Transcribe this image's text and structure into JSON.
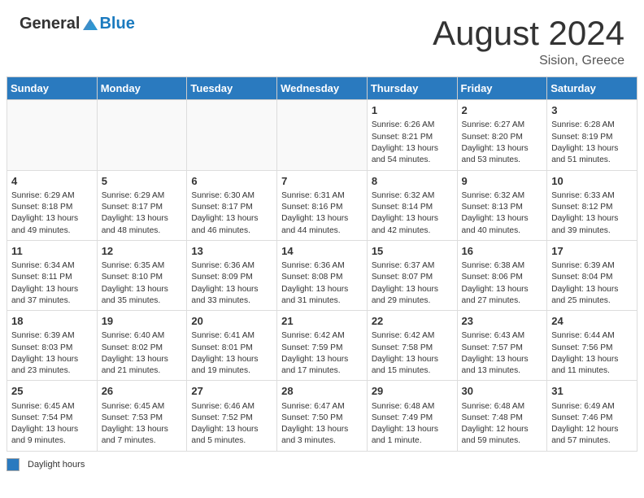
{
  "header": {
    "logo_general": "General",
    "logo_blue": "Blue",
    "month_title": "August 2024",
    "subtitle": "Sision, Greece"
  },
  "days_of_week": [
    "Sunday",
    "Monday",
    "Tuesday",
    "Wednesday",
    "Thursday",
    "Friday",
    "Saturday"
  ],
  "legend_label": "Daylight hours",
  "weeks": [
    [
      {
        "day": "",
        "info": ""
      },
      {
        "day": "",
        "info": ""
      },
      {
        "day": "",
        "info": ""
      },
      {
        "day": "",
        "info": ""
      },
      {
        "day": "1",
        "info": "Sunrise: 6:26 AM\nSunset: 8:21 PM\nDaylight: 13 hours and 54 minutes."
      },
      {
        "day": "2",
        "info": "Sunrise: 6:27 AM\nSunset: 8:20 PM\nDaylight: 13 hours and 53 minutes."
      },
      {
        "day": "3",
        "info": "Sunrise: 6:28 AM\nSunset: 8:19 PM\nDaylight: 13 hours and 51 minutes."
      }
    ],
    [
      {
        "day": "4",
        "info": "Sunrise: 6:29 AM\nSunset: 8:18 PM\nDaylight: 13 hours and 49 minutes."
      },
      {
        "day": "5",
        "info": "Sunrise: 6:29 AM\nSunset: 8:17 PM\nDaylight: 13 hours and 48 minutes."
      },
      {
        "day": "6",
        "info": "Sunrise: 6:30 AM\nSunset: 8:17 PM\nDaylight: 13 hours and 46 minutes."
      },
      {
        "day": "7",
        "info": "Sunrise: 6:31 AM\nSunset: 8:16 PM\nDaylight: 13 hours and 44 minutes."
      },
      {
        "day": "8",
        "info": "Sunrise: 6:32 AM\nSunset: 8:14 PM\nDaylight: 13 hours and 42 minutes."
      },
      {
        "day": "9",
        "info": "Sunrise: 6:32 AM\nSunset: 8:13 PM\nDaylight: 13 hours and 40 minutes."
      },
      {
        "day": "10",
        "info": "Sunrise: 6:33 AM\nSunset: 8:12 PM\nDaylight: 13 hours and 39 minutes."
      }
    ],
    [
      {
        "day": "11",
        "info": "Sunrise: 6:34 AM\nSunset: 8:11 PM\nDaylight: 13 hours and 37 minutes."
      },
      {
        "day": "12",
        "info": "Sunrise: 6:35 AM\nSunset: 8:10 PM\nDaylight: 13 hours and 35 minutes."
      },
      {
        "day": "13",
        "info": "Sunrise: 6:36 AM\nSunset: 8:09 PM\nDaylight: 13 hours and 33 minutes."
      },
      {
        "day": "14",
        "info": "Sunrise: 6:36 AM\nSunset: 8:08 PM\nDaylight: 13 hours and 31 minutes."
      },
      {
        "day": "15",
        "info": "Sunrise: 6:37 AM\nSunset: 8:07 PM\nDaylight: 13 hours and 29 minutes."
      },
      {
        "day": "16",
        "info": "Sunrise: 6:38 AM\nSunset: 8:06 PM\nDaylight: 13 hours and 27 minutes."
      },
      {
        "day": "17",
        "info": "Sunrise: 6:39 AM\nSunset: 8:04 PM\nDaylight: 13 hours and 25 minutes."
      }
    ],
    [
      {
        "day": "18",
        "info": "Sunrise: 6:39 AM\nSunset: 8:03 PM\nDaylight: 13 hours and 23 minutes."
      },
      {
        "day": "19",
        "info": "Sunrise: 6:40 AM\nSunset: 8:02 PM\nDaylight: 13 hours and 21 minutes."
      },
      {
        "day": "20",
        "info": "Sunrise: 6:41 AM\nSunset: 8:01 PM\nDaylight: 13 hours and 19 minutes."
      },
      {
        "day": "21",
        "info": "Sunrise: 6:42 AM\nSunset: 7:59 PM\nDaylight: 13 hours and 17 minutes."
      },
      {
        "day": "22",
        "info": "Sunrise: 6:42 AM\nSunset: 7:58 PM\nDaylight: 13 hours and 15 minutes."
      },
      {
        "day": "23",
        "info": "Sunrise: 6:43 AM\nSunset: 7:57 PM\nDaylight: 13 hours and 13 minutes."
      },
      {
        "day": "24",
        "info": "Sunrise: 6:44 AM\nSunset: 7:56 PM\nDaylight: 13 hours and 11 minutes."
      }
    ],
    [
      {
        "day": "25",
        "info": "Sunrise: 6:45 AM\nSunset: 7:54 PM\nDaylight: 13 hours and 9 minutes."
      },
      {
        "day": "26",
        "info": "Sunrise: 6:45 AM\nSunset: 7:53 PM\nDaylight: 13 hours and 7 minutes."
      },
      {
        "day": "27",
        "info": "Sunrise: 6:46 AM\nSunset: 7:52 PM\nDaylight: 13 hours and 5 minutes."
      },
      {
        "day": "28",
        "info": "Sunrise: 6:47 AM\nSunset: 7:50 PM\nDaylight: 13 hours and 3 minutes."
      },
      {
        "day": "29",
        "info": "Sunrise: 6:48 AM\nSunset: 7:49 PM\nDaylight: 13 hours and 1 minute."
      },
      {
        "day": "30",
        "info": "Sunrise: 6:48 AM\nSunset: 7:48 PM\nDaylight: 12 hours and 59 minutes."
      },
      {
        "day": "31",
        "info": "Sunrise: 6:49 AM\nSunset: 7:46 PM\nDaylight: 12 hours and 57 minutes."
      }
    ]
  ]
}
